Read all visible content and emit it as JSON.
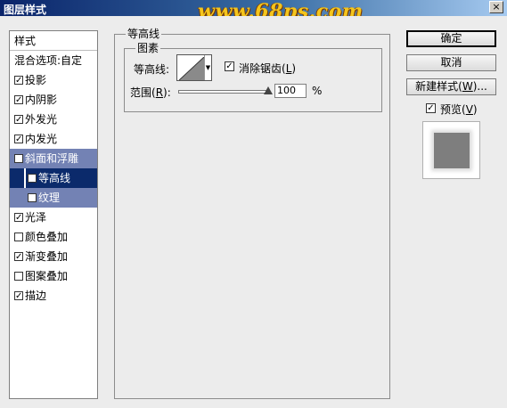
{
  "window": {
    "title": "图层样式",
    "watermark": "www.68ps.com",
    "close_label": "×"
  },
  "stylelist": {
    "header": "样式",
    "blend_options": "混合选项:自定",
    "items": [
      {
        "label": "投影",
        "checked": true
      },
      {
        "label": "内阴影",
        "checked": true
      },
      {
        "label": "外发光",
        "checked": true
      },
      {
        "label": "内发光",
        "checked": true
      },
      {
        "label": "斜面和浮雕",
        "checked": true
      },
      {
        "label": "等高线",
        "checked": true
      },
      {
        "label": "纹理",
        "checked": false
      },
      {
        "label": "光泽",
        "checked": true
      },
      {
        "label": "颜色叠加",
        "checked": false
      },
      {
        "label": "渐变叠加",
        "checked": true
      },
      {
        "label": "图案叠加",
        "checked": false
      },
      {
        "label": "描边",
        "checked": true
      }
    ]
  },
  "panel": {
    "group_title": "等高线",
    "subgroup_title": "图素",
    "contour_label": "等高线:",
    "antialias_label": "消除锯齿",
    "antialias_key": "L",
    "antialias_checked": true,
    "range_label": "范围",
    "range_key": "R",
    "range_value": "100",
    "range_unit": "%"
  },
  "buttons": {
    "ok": "确定",
    "cancel": "取消",
    "new_style": "新建样式",
    "new_style_key": "W",
    "new_style_suffix": "...",
    "preview_label": "预览",
    "preview_key": "V",
    "preview_checked": true
  }
}
